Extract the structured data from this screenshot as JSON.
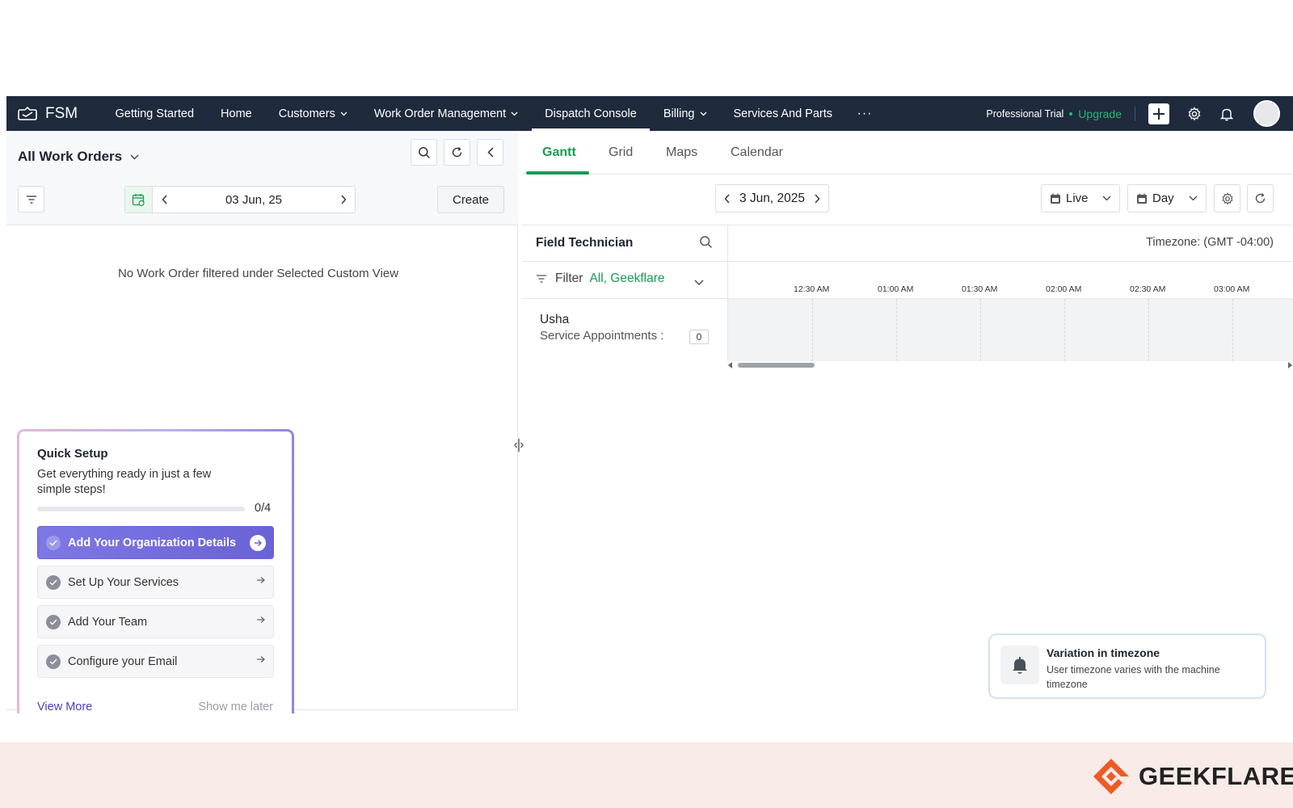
{
  "nav": {
    "brand": "FSM",
    "items": [
      {
        "label": "Getting Started",
        "dropdown": false
      },
      {
        "label": "Home",
        "dropdown": false
      },
      {
        "label": "Customers",
        "dropdown": true
      },
      {
        "label": "Work Order Management",
        "dropdown": true
      },
      {
        "label": "Dispatch Console",
        "dropdown": false,
        "active": true
      },
      {
        "label": "Billing",
        "dropdown": true
      },
      {
        "label": "Services And Parts",
        "dropdown": false
      }
    ],
    "more": "···",
    "trial": "Professional Trial",
    "upgrade": "Upgrade"
  },
  "left": {
    "title": "All Work Orders",
    "date": "03 Jun, 25",
    "create": "Create",
    "empty": "No Work Order filtered under Selected Custom View"
  },
  "quick_setup": {
    "title": "Quick Setup",
    "subtitle": "Get everything ready in just a few simple steps!",
    "progress": "0/4",
    "progress_fraction": 0,
    "steps": [
      "Add Your Organization Details",
      "Set Up Your Services",
      "Add Your Team",
      "Configure your Email"
    ],
    "view_more": "View More",
    "later": "Show me later"
  },
  "right": {
    "tabs": [
      "Gantt",
      "Grid",
      "Maps",
      "Calendar"
    ],
    "date": "3 Jun, 2025",
    "mode": "Live",
    "period": "Day",
    "field_technician": "Field Technician",
    "filter_label": "Filter",
    "filter_value": "All, Geekflare",
    "timezone": "Timezone: (GMT -04:00)",
    "ticks": [
      "12:30 AM",
      "01:00 AM",
      "01:30 AM",
      "02:00 AM",
      "02:30 AM",
      "03:00 AM"
    ],
    "technician": {
      "name": "Usha",
      "label": "Service Appointments :",
      "count": "0"
    }
  },
  "toast": {
    "title": "Variation in timezone",
    "body": "User timezone varies with the machine timezone"
  },
  "watermark": "GEEKFLARE",
  "colors": {
    "nav_bg": "#1f2a3d",
    "accent_green": "#1a9a55",
    "setup_purple": "#6a62d6"
  }
}
